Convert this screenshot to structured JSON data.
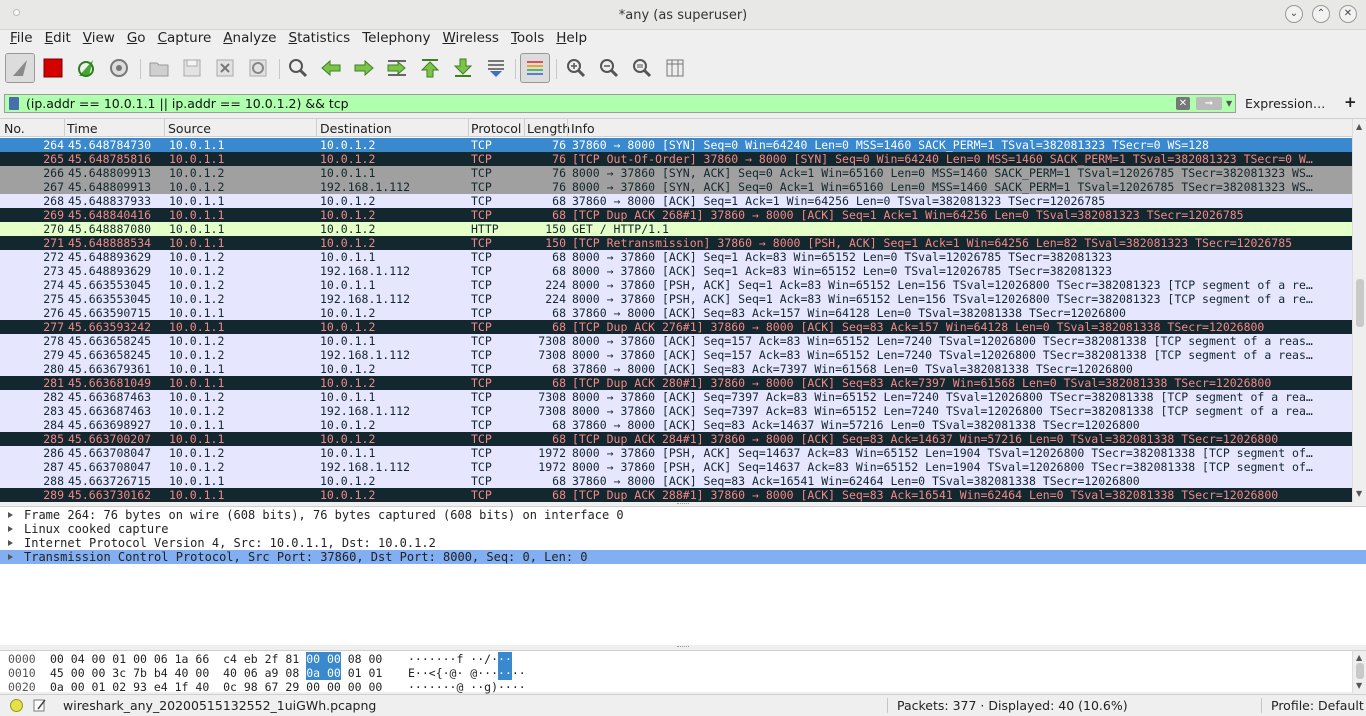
{
  "window": {
    "title": "*any (as superuser)"
  },
  "menu": [
    {
      "u": "F",
      "rest": "ile"
    },
    {
      "u": "E",
      "rest": "dit"
    },
    {
      "u": "V",
      "rest": "iew"
    },
    {
      "u": "G",
      "rest": "o"
    },
    {
      "u": "C",
      "rest": "apture"
    },
    {
      "u": "A",
      "rest": "nalyze"
    },
    {
      "u": "S",
      "rest": "tatistics"
    },
    {
      "u": "",
      "rest": "Telephony"
    },
    {
      "u": "W",
      "rest": "ireless"
    },
    {
      "u": "T",
      "rest": "ools"
    },
    {
      "u": "H",
      "rest": "elp"
    }
  ],
  "filter": {
    "text": "(ip.addr == 10.0.1.1 || ip.addr == 10.0.1.2) && tcp",
    "expression_label": "Expression…",
    "add_label": "+"
  },
  "columns": [
    "No.",
    "Time",
    "Source",
    "Destination",
    "Protocol",
    "Length",
    "Info"
  ],
  "packets": [
    {
      "no": "264",
      "time": "45.648784730",
      "src": "10.0.1.1",
      "dst": "10.0.1.2",
      "proto": "TCP",
      "len": "76",
      "info": "37860 → 8000 [SYN] Seq=0 Win=64240 Len=0 MSS=1460 SACK_PERM=1 TSval=382081323 TSecr=0 WS=128",
      "style": "sel"
    },
    {
      "no": "265",
      "time": "45.648785816",
      "src": "10.0.1.1",
      "dst": "10.0.1.2",
      "proto": "TCP",
      "len": "76",
      "info": "[TCP Out-Of-Order] 37860 → 8000 [SYN] Seq=0 Win=64240 Len=0 MSS=1460 SACK_PERM=1 TSval=382081323 TSecr=0 W…",
      "style": "bad"
    },
    {
      "no": "266",
      "time": "45.648809913",
      "src": "10.0.1.2",
      "dst": "10.0.1.1",
      "proto": "TCP",
      "len": "76",
      "info": "8000 → 37860 [SYN, ACK] Seq=0 Ack=1 Win=65160 Len=0 MSS=1460 SACK_PERM=1 TSval=12026785 TSecr=382081323 WS…",
      "style": "gray"
    },
    {
      "no": "267",
      "time": "45.648809913",
      "src": "10.0.1.2",
      "dst": "192.168.1.112",
      "proto": "TCP",
      "len": "76",
      "info": "8000 → 37860 [SYN, ACK] Seq=0 Ack=1 Win=65160 Len=0 MSS=1460 SACK_PERM=1 TSval=12026785 TSecr=382081323 WS…",
      "style": "gray"
    },
    {
      "no": "268",
      "time": "45.648837933",
      "src": "10.0.1.1",
      "dst": "10.0.1.2",
      "proto": "TCP",
      "len": "68",
      "info": "37860 → 8000 [ACK] Seq=1 Ack=1 Win=64256 Len=0 TSval=382081323 TSecr=12026785",
      "style": "tcp"
    },
    {
      "no": "269",
      "time": "45.648840416",
      "src": "10.0.1.1",
      "dst": "10.0.1.2",
      "proto": "TCP",
      "len": "68",
      "info": "[TCP Dup ACK 268#1] 37860 → 8000 [ACK] Seq=1 Ack=1 Win=64256 Len=0 TSval=382081323 TSecr=12026785",
      "style": "bad"
    },
    {
      "no": "270",
      "time": "45.648887080",
      "src": "10.0.1.1",
      "dst": "10.0.1.2",
      "proto": "HTTP",
      "len": "150",
      "info": "GET / HTTP/1.1",
      "style": "http"
    },
    {
      "no": "271",
      "time": "45.648888534",
      "src": "10.0.1.1",
      "dst": "10.0.1.2",
      "proto": "TCP",
      "len": "150",
      "info": "[TCP Retransmission] 37860 → 8000 [PSH, ACK] Seq=1 Ack=1 Win=64256 Len=82 TSval=382081323 TSecr=12026785",
      "style": "bad"
    },
    {
      "no": "272",
      "time": "45.648893629",
      "src": "10.0.1.2",
      "dst": "10.0.1.1",
      "proto": "TCP",
      "len": "68",
      "info": "8000 → 37860 [ACK] Seq=1 Ack=83 Win=65152 Len=0 TSval=12026785 TSecr=382081323",
      "style": "tcp"
    },
    {
      "no": "273",
      "time": "45.648893629",
      "src": "10.0.1.2",
      "dst": "192.168.1.112",
      "proto": "TCP",
      "len": "68",
      "info": "8000 → 37860 [ACK] Seq=1 Ack=83 Win=65152 Len=0 TSval=12026785 TSecr=382081323",
      "style": "tcp"
    },
    {
      "no": "274",
      "time": "45.663553045",
      "src": "10.0.1.2",
      "dst": "10.0.1.1",
      "proto": "TCP",
      "len": "224",
      "info": "8000 → 37860 [PSH, ACK] Seq=1 Ack=83 Win=65152 Len=156 TSval=12026800 TSecr=382081323 [TCP segment of a re…",
      "style": "tcp"
    },
    {
      "no": "275",
      "time": "45.663553045",
      "src": "10.0.1.2",
      "dst": "192.168.1.112",
      "proto": "TCP",
      "len": "224",
      "info": "8000 → 37860 [PSH, ACK] Seq=1 Ack=83 Win=65152 Len=156 TSval=12026800 TSecr=382081323 [TCP segment of a re…",
      "style": "tcp"
    },
    {
      "no": "276",
      "time": "45.663590715",
      "src": "10.0.1.1",
      "dst": "10.0.1.2",
      "proto": "TCP",
      "len": "68",
      "info": "37860 → 8000 [ACK] Seq=83 Ack=157 Win=64128 Len=0 TSval=382081338 TSecr=12026800",
      "style": "tcp"
    },
    {
      "no": "277",
      "time": "45.663593242",
      "src": "10.0.1.1",
      "dst": "10.0.1.2",
      "proto": "TCP",
      "len": "68",
      "info": "[TCP Dup ACK 276#1] 37860 → 8000 [ACK] Seq=83 Ack=157 Win=64128 Len=0 TSval=382081338 TSecr=12026800",
      "style": "bad"
    },
    {
      "no": "278",
      "time": "45.663658245",
      "src": "10.0.1.2",
      "dst": "10.0.1.1",
      "proto": "TCP",
      "len": "7308",
      "info": "8000 → 37860 [ACK] Seq=157 Ack=83 Win=65152 Len=7240 TSval=12026800 TSecr=382081338 [TCP segment of a reas…",
      "style": "tcp"
    },
    {
      "no": "279",
      "time": "45.663658245",
      "src": "10.0.1.2",
      "dst": "192.168.1.112",
      "proto": "TCP",
      "len": "7308",
      "info": "8000 → 37860 [ACK] Seq=157 Ack=83 Win=65152 Len=7240 TSval=12026800 TSecr=382081338 [TCP segment of a reas…",
      "style": "tcp"
    },
    {
      "no": "280",
      "time": "45.663679361",
      "src": "10.0.1.1",
      "dst": "10.0.1.2",
      "proto": "TCP",
      "len": "68",
      "info": "37860 → 8000 [ACK] Seq=83 Ack=7397 Win=61568 Len=0 TSval=382081338 TSecr=12026800",
      "style": "tcp"
    },
    {
      "no": "281",
      "time": "45.663681049",
      "src": "10.0.1.1",
      "dst": "10.0.1.2",
      "proto": "TCP",
      "len": "68",
      "info": "[TCP Dup ACK 280#1] 37860 → 8000 [ACK] Seq=83 Ack=7397 Win=61568 Len=0 TSval=382081338 TSecr=12026800",
      "style": "bad"
    },
    {
      "no": "282",
      "time": "45.663687463",
      "src": "10.0.1.2",
      "dst": "10.0.1.1",
      "proto": "TCP",
      "len": "7308",
      "info": "8000 → 37860 [ACK] Seq=7397 Ack=83 Win=65152 Len=7240 TSval=12026800 TSecr=382081338 [TCP segment of a rea…",
      "style": "tcp"
    },
    {
      "no": "283",
      "time": "45.663687463",
      "src": "10.0.1.2",
      "dst": "192.168.1.112",
      "proto": "TCP",
      "len": "7308",
      "info": "8000 → 37860 [ACK] Seq=7397 Ack=83 Win=65152 Len=7240 TSval=12026800 TSecr=382081338 [TCP segment of a rea…",
      "style": "tcp"
    },
    {
      "no": "284",
      "time": "45.663698927",
      "src": "10.0.1.1",
      "dst": "10.0.1.2",
      "proto": "TCP",
      "len": "68",
      "info": "37860 → 8000 [ACK] Seq=83 Ack=14637 Win=57216 Len=0 TSval=382081338 TSecr=12026800",
      "style": "tcp"
    },
    {
      "no": "285",
      "time": "45.663700207",
      "src": "10.0.1.1",
      "dst": "10.0.1.2",
      "proto": "TCP",
      "len": "68",
      "info": "[TCP Dup ACK 284#1] 37860 → 8000 [ACK] Seq=83 Ack=14637 Win=57216 Len=0 TSval=382081338 TSecr=12026800",
      "style": "bad"
    },
    {
      "no": "286",
      "time": "45.663708047",
      "src": "10.0.1.2",
      "dst": "10.0.1.1",
      "proto": "TCP",
      "len": "1972",
      "info": "8000 → 37860 [PSH, ACK] Seq=14637 Ack=83 Win=65152 Len=1904 TSval=12026800 TSecr=382081338 [TCP segment of…",
      "style": "tcp"
    },
    {
      "no": "287",
      "time": "45.663708047",
      "src": "10.0.1.2",
      "dst": "192.168.1.112",
      "proto": "TCP",
      "len": "1972",
      "info": "8000 → 37860 [PSH, ACK] Seq=14637 Ack=83 Win=65152 Len=1904 TSval=12026800 TSecr=382081338 [TCP segment of…",
      "style": "tcp"
    },
    {
      "no": "288",
      "time": "45.663726715",
      "src": "10.0.1.1",
      "dst": "10.0.1.2",
      "proto": "TCP",
      "len": "68",
      "info": "37860 → 8000 [ACK] Seq=83 Ack=16541 Win=62464 Len=0 TSval=382081338 TSecr=12026800",
      "style": "tcp"
    },
    {
      "no": "289",
      "time": "45.663730162",
      "src": "10.0.1.1",
      "dst": "10.0.1.2",
      "proto": "TCP",
      "len": "68",
      "info": "[TCP Dup ACK 288#1] 37860 → 8000 [ACK] Seq=83 Ack=16541 Win=62464 Len=0 TSval=382081338 TSecr=12026800",
      "style": "bad"
    }
  ],
  "details": [
    {
      "text": "Frame 264: 76 bytes on wire (608 bits), 76 bytes captured (608 bits) on interface 0",
      "selected": false
    },
    {
      "text": "Linux cooked capture",
      "selected": false
    },
    {
      "text": "Internet Protocol Version 4, Src: 10.0.1.1, Dst: 10.0.1.2",
      "selected": false
    },
    {
      "text": "Transmission Control Protocol, Src Port: 37860, Dst Port: 8000, Seq: 0, Len: 0",
      "selected": true
    }
  ],
  "bytes": [
    {
      "offset": "0000",
      "hex_pre": "00 04 00 01 00 06 1a 66  c4 eb 2f 81 ",
      "hex_hl": "00 00",
      "hex_post": " 08 00",
      "asc_pre": "·······f ··/·",
      "asc_hl": "··",
      "asc_post": ""
    },
    {
      "offset": "0010",
      "hex_pre": "45 00 00 3c 7b b4 40 00  40 06 a9 08 ",
      "hex_hl": "0a 00",
      "hex_post": " 01 01",
      "asc_pre": "E··<{·@· @···",
      "asc_hl": "··",
      "asc_post": "··"
    },
    {
      "offset": "0020",
      "hex_pre": "0a 00 01 02 93 e4 1f 40  0c 98 67 29 00 00 00 00",
      "hex_hl": "",
      "hex_post": "",
      "asc_pre": "·······@ ··g)····",
      "asc_hl": "",
      "asc_post": ""
    }
  ],
  "status": {
    "file": "wireshark_any_20200515132552_1uiGWh.pcapng",
    "packets": "Packets: 377 · Displayed: 40 (10.6%)",
    "profile": "Profile: Default"
  }
}
